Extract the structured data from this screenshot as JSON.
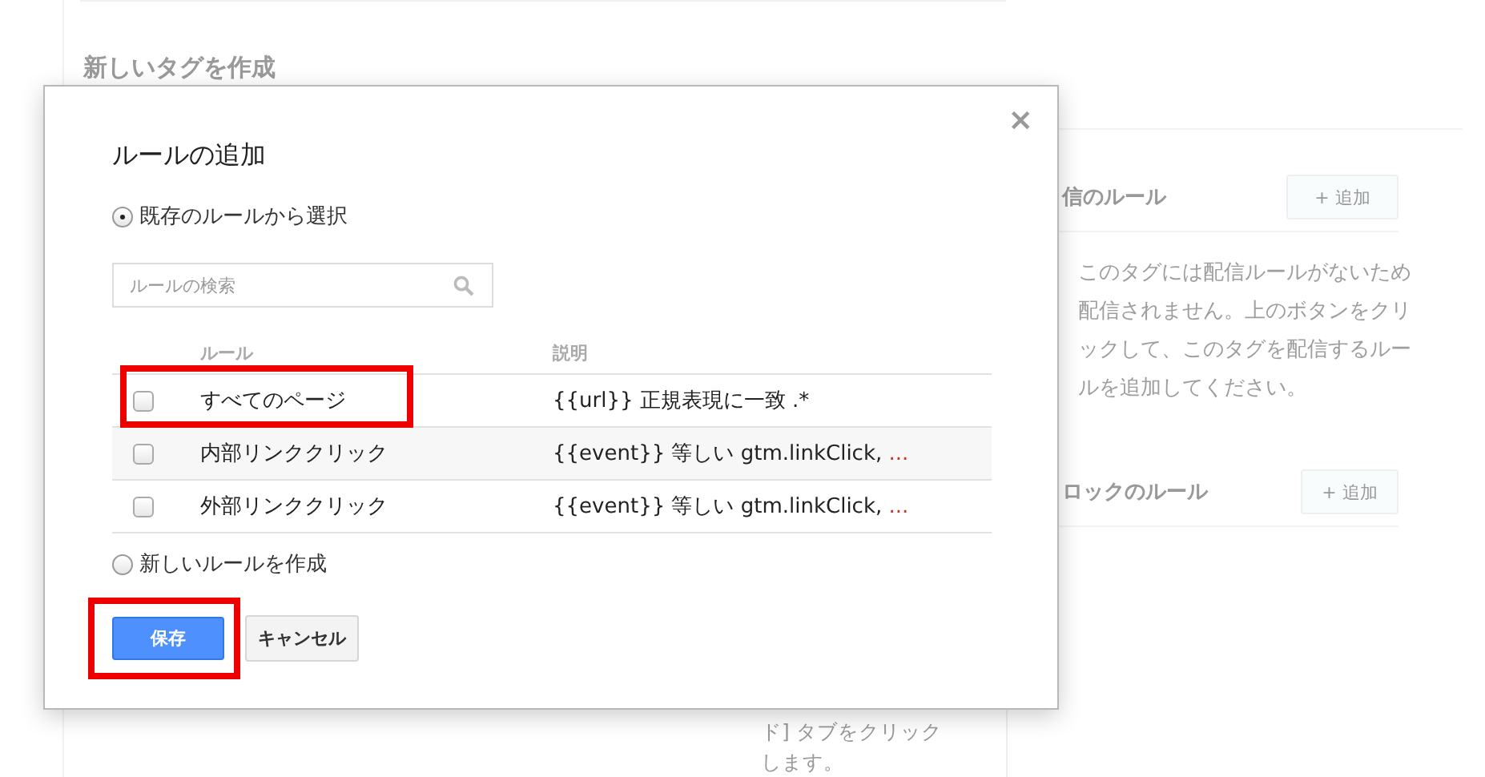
{
  "page": {
    "title": "新しいタグを作成",
    "fire_rules": {
      "heading": "信のルール",
      "add_button": "+ 追加",
      "message": "このタグには配信ルールがないため配信されません。上のボタンをクリックして、このタグを配信するルールを追加してください。"
    },
    "block_rules": {
      "heading": "ロックのルール",
      "add_button": "+ 追加"
    },
    "hint_lines": [
      "ド] タブをクリック",
      "します。"
    ]
  },
  "dialog": {
    "title": "ルールの追加",
    "close": "×",
    "options": [
      {
        "label": "既存のルールから選択",
        "selected": true
      },
      {
        "label": "新しいルールを作成",
        "selected": false
      }
    ],
    "search": {
      "placeholder": "ルールの検索"
    },
    "columns": [
      "ルール",
      "説明"
    ],
    "rules": [
      {
        "name": "すべてのページ",
        "description": "{{url}} 正規表現に一致 .*",
        "checked": false,
        "highlighted": true
      },
      {
        "name": "内部リンククリック",
        "description": "{{event}} 等しい gtm.linkClick, ",
        "more": "...",
        "checked": false,
        "highlighted": false
      },
      {
        "name": "外部リンククリック",
        "description": "{{event}} 等しい gtm.linkClick, ",
        "more": "...",
        "checked": false,
        "highlighted": false
      }
    ],
    "save_button": {
      "label": "保存",
      "highlighted": true
    },
    "cancel_button": {
      "label": "キャンセル"
    }
  }
}
